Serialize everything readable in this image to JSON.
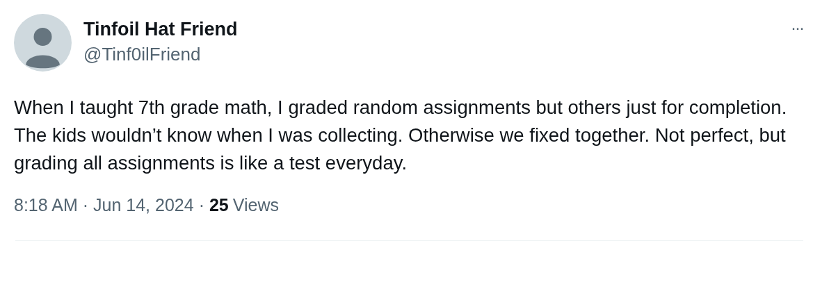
{
  "post": {
    "author_name": "Tinfoil Hat Friend",
    "handle": "@Tinf0ilFriend",
    "more_menu": "···",
    "text": "When I taught 7th grade math, I graded random assignments but others just for completion. The kids wouldn’t know when I was collecting. Otherwise we fixed together. Not perfect, but grading all assignments is like a test everyday.",
    "meta": {
      "time": "8:18 AM",
      "separator_1": "·",
      "date": "Jun 14, 2024",
      "separator_2": "·",
      "views_count": "25",
      "views_label": "Views"
    }
  }
}
